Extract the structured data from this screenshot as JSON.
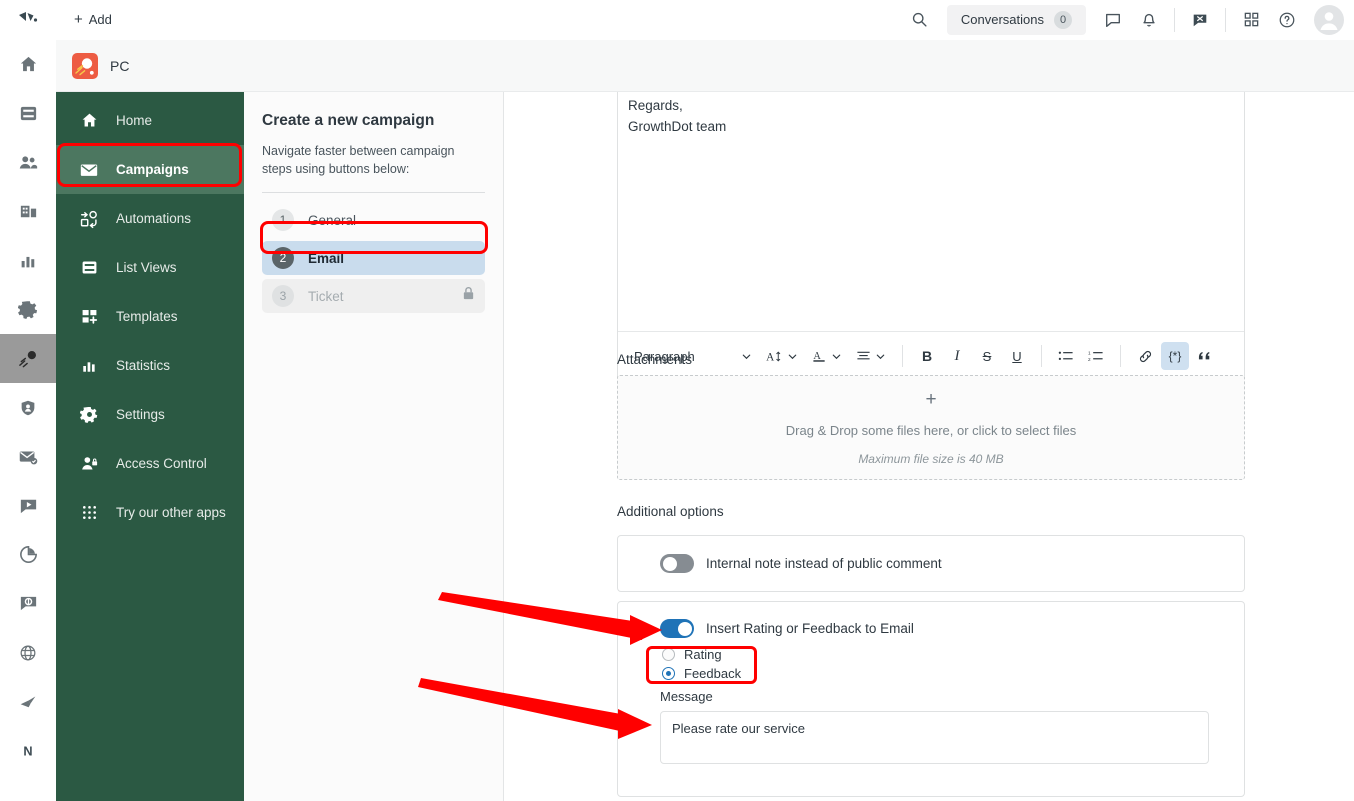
{
  "topbar": {
    "logo_icon": "zendesk-logo-icon",
    "add_label": "Add",
    "add_icon": "plus-icon",
    "search_icon": "search-icon",
    "conversations_label": "Conversations",
    "conversations_count": "0",
    "chat_icon": "speech-bubble-icon",
    "bell_icon": "bell-icon",
    "messaging_icon": "messaging-close-icon",
    "apps_icon": "grid-apps-icon",
    "help_icon": "question-circle-icon",
    "avatar_icon": "user-avatar-icon"
  },
  "rail": {
    "items": [
      {
        "icon": "home-icon",
        "name": "rail-item-home",
        "active": false
      },
      {
        "icon": "views-icon",
        "name": "rail-item-views",
        "active": false
      },
      {
        "icon": "customers-icon",
        "name": "rail-item-customers",
        "active": false
      },
      {
        "icon": "organizations-icon",
        "name": "rail-item-organizations",
        "active": false
      },
      {
        "icon": "reporting-icon",
        "name": "rail-item-reporting",
        "active": false
      },
      {
        "icon": "admin-gear-icon",
        "name": "rail-item-admin",
        "active": false
      },
      {
        "icon": "campaign-rocket-icon",
        "name": "rail-item-campaigns",
        "active": true
      },
      {
        "icon": "shield-user-icon",
        "name": "rail-item-access",
        "active": false
      },
      {
        "icon": "email-check-icon",
        "name": "rail-item-email",
        "active": false
      },
      {
        "icon": "video-play-icon",
        "name": "rail-item-video",
        "active": false
      },
      {
        "icon": "pie-chart-icon",
        "name": "rail-item-analytics",
        "active": false
      },
      {
        "icon": "chat-refresh-icon",
        "name": "rail-item-chat",
        "active": false
      },
      {
        "icon": "globe-icon",
        "name": "rail-item-globe",
        "active": false
      },
      {
        "icon": "broom-icon",
        "name": "rail-item-cleanup",
        "active": false
      },
      {
        "icon": "letter-n-icon",
        "name": "rail-item-notify",
        "active": false
      }
    ]
  },
  "breadcrumb": {
    "app_icon": "pc-app-icon",
    "title": "PC"
  },
  "sidebar": {
    "items": [
      {
        "label": "Home",
        "icon": "home-icon",
        "active": false
      },
      {
        "label": "Campaigns",
        "icon": "envelope-icon",
        "active": true
      },
      {
        "label": "Automations",
        "icon": "automation-flow-icon",
        "active": false
      },
      {
        "label": "List Views",
        "icon": "list-views-icon",
        "active": false
      },
      {
        "label": "Templates",
        "icon": "templates-grid-plus-icon",
        "active": false
      },
      {
        "label": "Statistics",
        "icon": "bar-chart-icon",
        "active": false
      },
      {
        "label": "Settings",
        "icon": "gear-icon",
        "active": false
      },
      {
        "label": "Access Control",
        "icon": "user-lock-icon",
        "active": false
      },
      {
        "label": "Try our other apps",
        "icon": "dots-grid-icon",
        "active": false
      }
    ]
  },
  "steps_panel": {
    "title": "Create a new campaign",
    "subtitle": "Navigate faster between campaign steps using buttons below:",
    "steps": [
      {
        "num": "1",
        "label": "General",
        "state": "default"
      },
      {
        "num": "2",
        "label": "Email",
        "state": "current"
      },
      {
        "num": "3",
        "label": "Ticket",
        "state": "locked",
        "icon": "lock-icon"
      }
    ]
  },
  "editor": {
    "content_line1": "Regards,",
    "content_line2": "GrowthDot team",
    "toolbar": {
      "paragraph_label": "Paragraph",
      "font_size_icon": "font-size-icon",
      "font_color_icon": "font-color-icon",
      "align_icon": "align-left-icon",
      "bold_label": "B",
      "italic_label": "I",
      "strike_label": "S",
      "underline_label": "U",
      "bullet_list_icon": "bullet-list-icon",
      "numbered_list_icon": "numbered-list-icon",
      "link_icon": "link-icon",
      "placeholder_label": "{*}",
      "quote_icon": "blockquote-icon",
      "code_icon": "code-brackets-icon",
      "source_icon": "source-code-icon",
      "chevron_icon": "chevron-down-icon",
      "clear_format_icon": "clear-formatting-icon",
      "signature_icon": "signature-envelope-icon",
      "image_icon": "image-icon",
      "html_icon": "html-block-icon"
    }
  },
  "attachments": {
    "label": "Attachments",
    "plus_icon": "plus-icon",
    "drop_text": "Drag & Drop some files here, or click to select files",
    "max_size_text": "Maximum file size is 40 MB"
  },
  "additional_options": {
    "label": "Additional options",
    "internal_note": {
      "label": "Internal note instead of public comment",
      "enabled": false
    },
    "insert_rating": {
      "label": "Insert Rating or Feedback to Email",
      "enabled": true,
      "options": [
        {
          "label": "Rating",
          "selected": false
        },
        {
          "label": "Feedback",
          "selected": true
        }
      ],
      "message_label": "Message",
      "message_value": "Please rate our service",
      "message_placeholder": "Please rate our service"
    }
  },
  "annotations": {
    "highlight_color": "#ff0000",
    "arrow_color": "#ff0000",
    "arrow_1_target": "insert-rating-toggle",
    "arrow_2_target": "message-textarea",
    "boxes": [
      "sidebar-item-campaigns",
      "step-email",
      "rating-feedback-radio-group"
    ]
  },
  "theme": {
    "sidebar_green": "#2b5943",
    "sidebar_active_green": "#4c7760",
    "accent_blue": "#1f73b7",
    "step_current_blue": "#c9dced",
    "brand_orange": "#ed5c43"
  }
}
